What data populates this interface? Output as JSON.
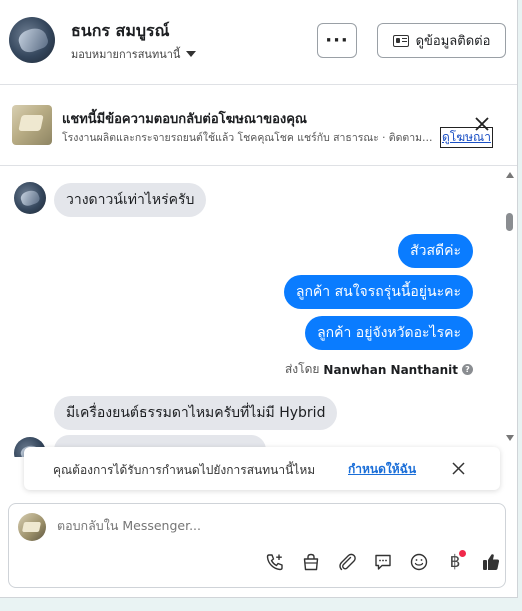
{
  "header": {
    "name": "ธนกร สมบูรณ์",
    "assign_label": "มอบหมายการสนทนานี้",
    "more_label": "···",
    "contact_label": "ดูข้อมูลติดต่อ"
  },
  "ad_banner": {
    "title": "แชทนี้มีข้อความตอบกลับต่อโฆษณาของคุณ",
    "subtitle": "โรงงานผลิตและกระจายรถยนต์ใช้แล้ว โชคคุณโชค แชร์กับ สาธารณะ · ติดตามผลโฆษณา",
    "link": "ดูโฆษณา"
  },
  "messages": [
    {
      "dir": "in",
      "text": "วางดาวน์เท่าไหร่ครับ"
    },
    {
      "dir": "out",
      "text": "สัวสดีค่ะ"
    },
    {
      "dir": "out",
      "text": "ลูกค้า สนใจรถรุ่นนี้อยู่นะคะ"
    },
    {
      "dir": "out",
      "text": "ลูกค้า  อยู่จังหวัดอะไรคะ"
    },
    {
      "dir": "in",
      "text": "มีเครื่องยนต์ธรรมดาไหมครับที่ไม่มี Hybrid"
    }
  ],
  "sent_by": {
    "prefix": "ส่งโดย",
    "name": "Nanwhan Nanthanit",
    "info": "?"
  },
  "toast": {
    "text": "คุณต้องการได้รับการกำหนดไปยังการสนทนานี้ไหม",
    "link": "กำหนดให้ฉัน"
  },
  "composer": {
    "placeholder": "ตอบกลับใน Messenger...",
    "baht_symbol": "฿"
  },
  "colors": {
    "outgoing_bubble": "#0a7cff",
    "incoming_bubble": "#e4e6eb",
    "link_blue": "#1a6ed8",
    "notification_dot": "#f0284a"
  }
}
